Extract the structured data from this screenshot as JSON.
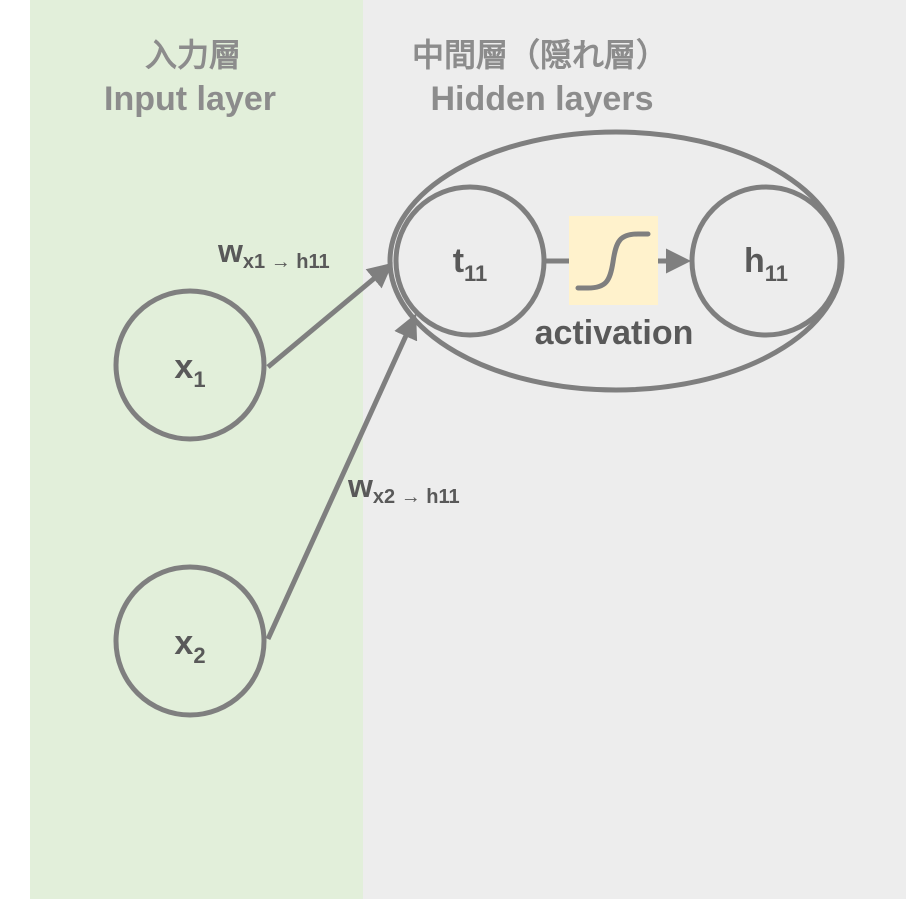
{
  "input_layer": {
    "title_ja": "入力層",
    "title_en": "Input layer",
    "background_color": "#e2efda"
  },
  "hidden_layers": {
    "title_ja": "中間層（隠れ層）",
    "title_en": "Hidden layers",
    "background_color": "#ededed"
  },
  "nodes": {
    "x1": {
      "base": "x",
      "sub": "1"
    },
    "x2": {
      "base": "x",
      "sub": "2"
    },
    "t11": {
      "base": "t",
      "sub": "11"
    },
    "h11": {
      "base": "h",
      "sub": "11"
    }
  },
  "edges": {
    "w1": {
      "base": "w",
      "sub": "x1 → h11"
    },
    "w2": {
      "base": "w",
      "sub": "x2 → h11"
    }
  },
  "activation": {
    "label": "activation",
    "box_color": "#fff2cc",
    "icon": "sigmoid-curve-icon"
  },
  "colors": {
    "stroke": "#7f7f7f",
    "title_text": "#8c8c8c",
    "node_text": "#595959"
  }
}
